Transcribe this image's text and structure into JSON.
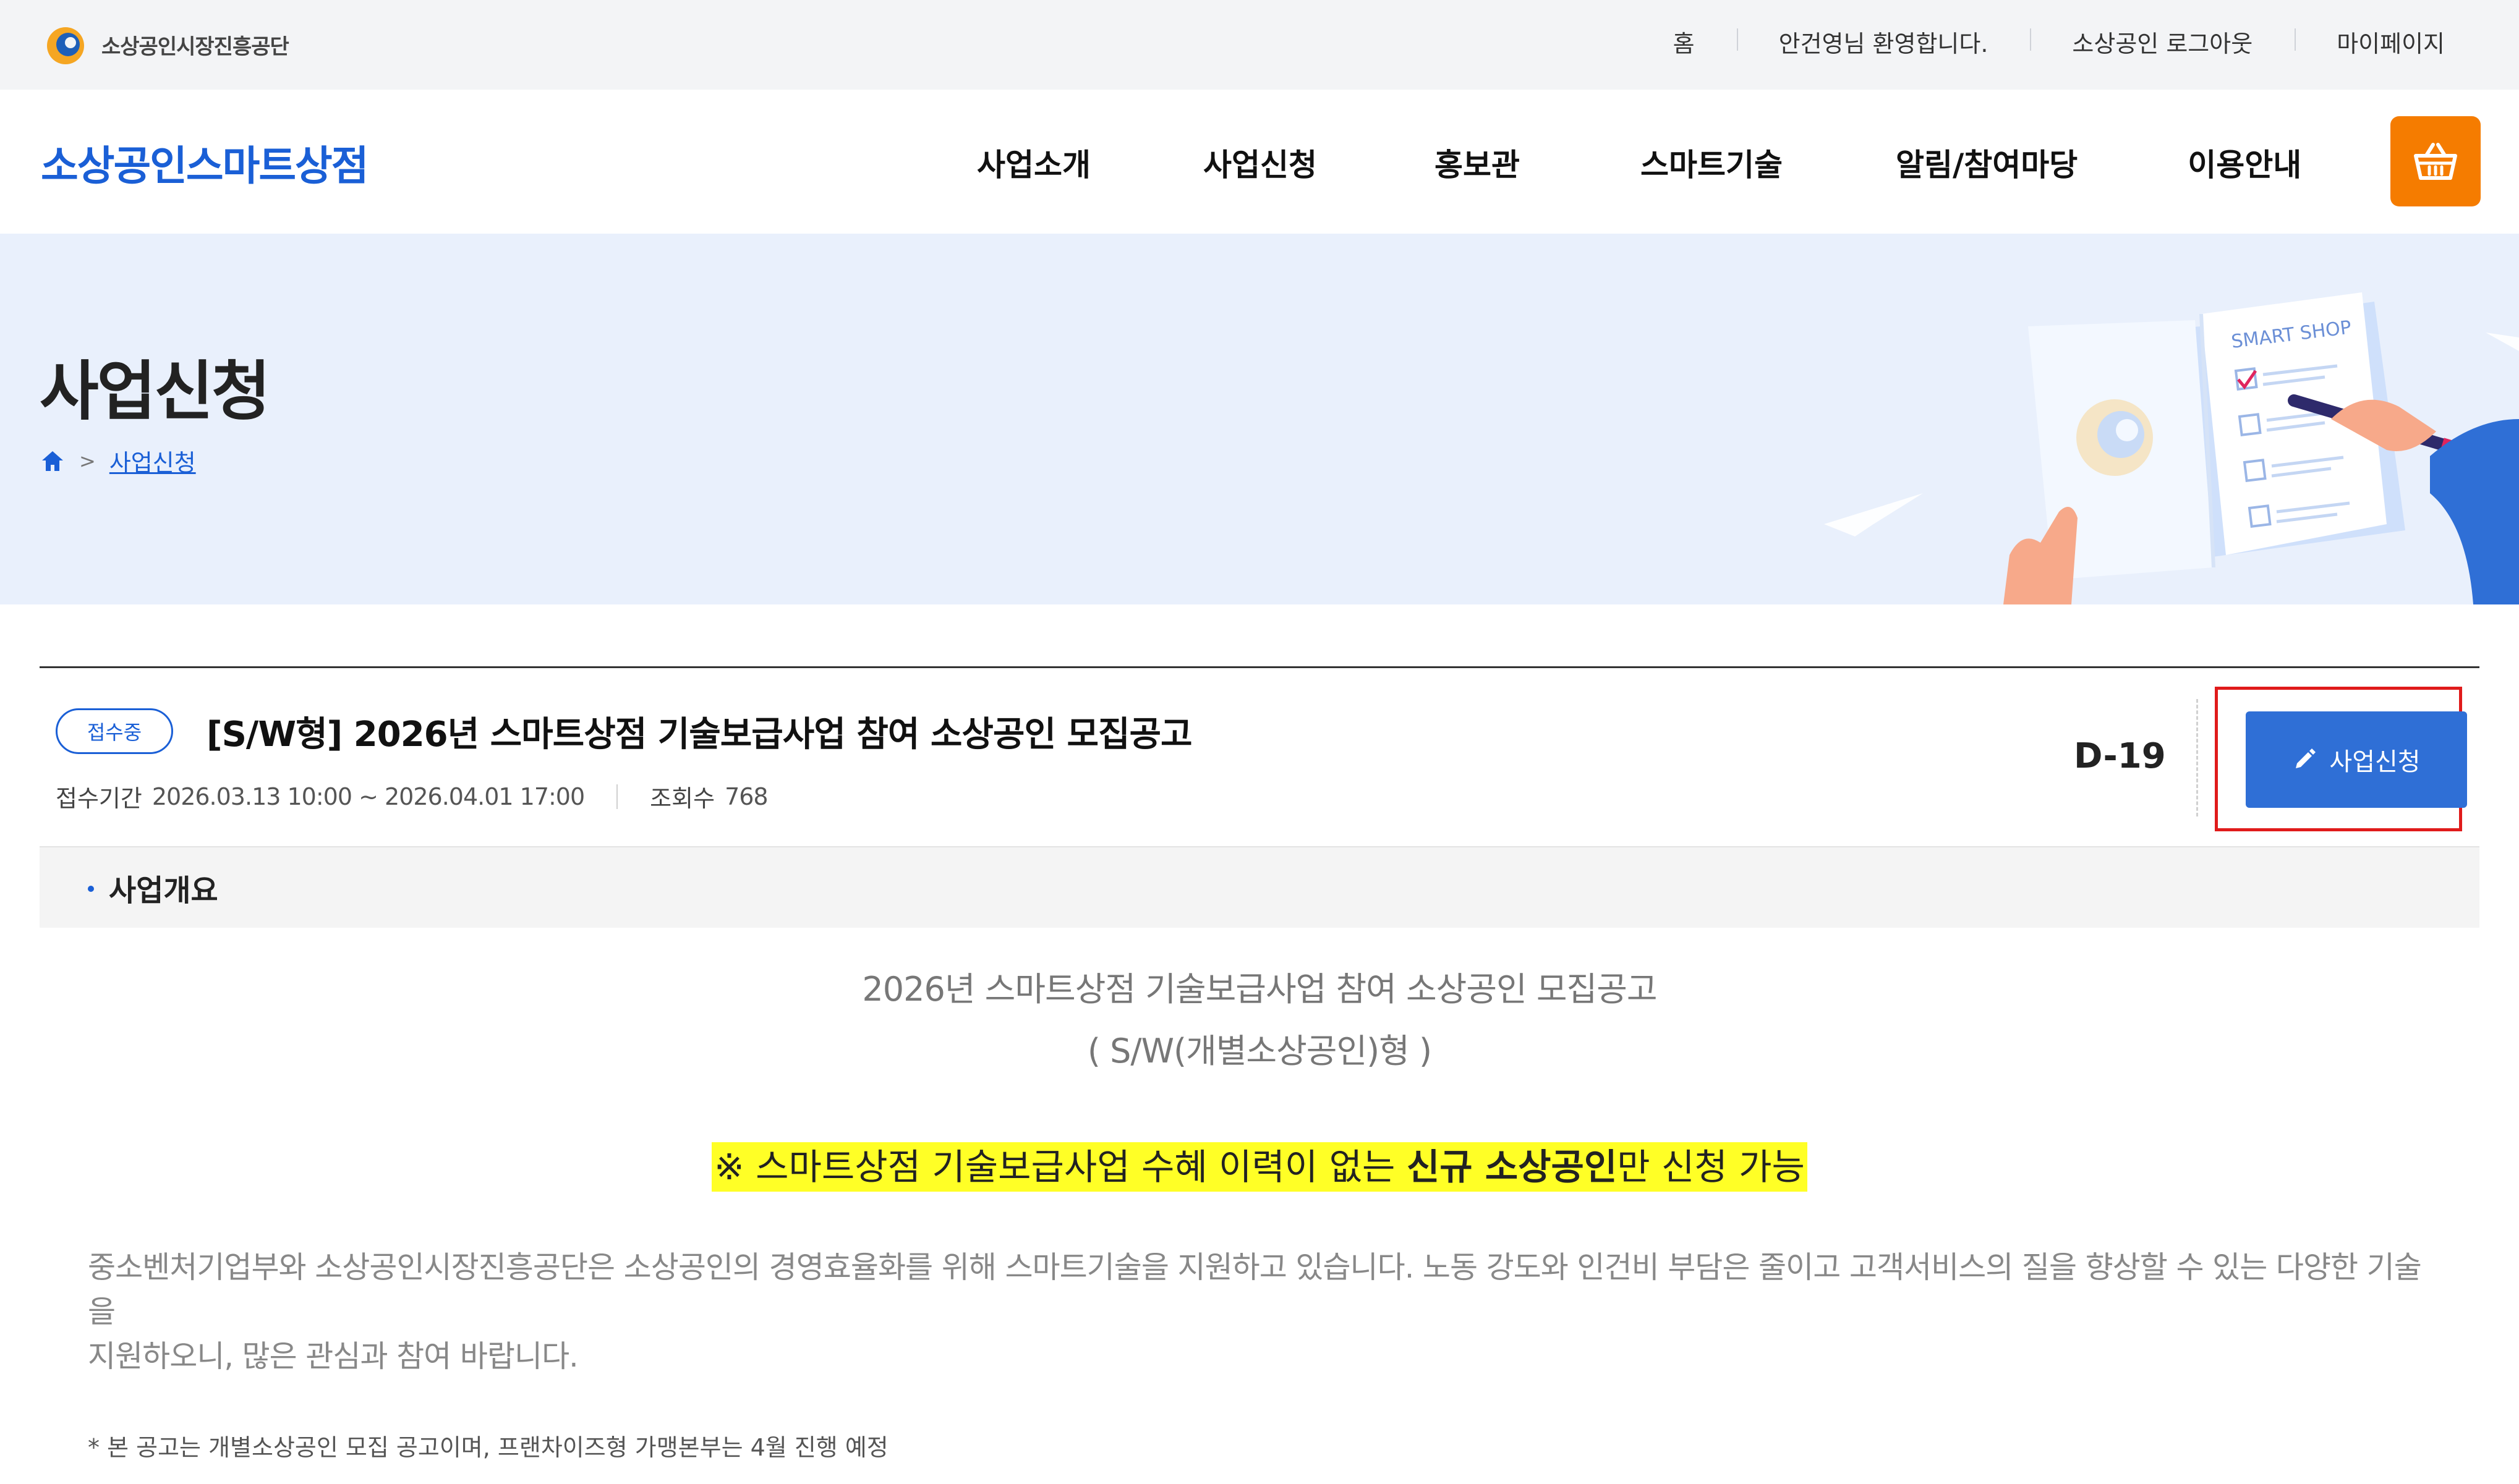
{
  "topbar": {
    "org_name": "소상공인시장진흥공단",
    "links": [
      "홈",
      "안건영님 환영합니다.",
      "소상공인 로그아웃",
      "마이페이지"
    ]
  },
  "header": {
    "brand": "소상공인스마트상점",
    "menu": [
      "사업소개",
      "사업신청",
      "홍보관",
      "스마트기술",
      "알림/참여마당",
      "이용안내"
    ],
    "cart_icon": "basket-icon",
    "accent_color": "#f57c00"
  },
  "hero": {
    "title": "사업신청",
    "breadcrumb": "사업신청",
    "illustration_text": "SMART SHOP"
  },
  "notice": {
    "status_badge": "접수중",
    "title": "[S/W형] 2026년 스마트상점 기술보급사업 참여 소상공인 모집공고",
    "period_label": "접수기간",
    "period_value": "2026.03.13 10:00 ~ 2026.04.01 17:00",
    "views_label": "조회수",
    "views_value": "768",
    "dday": "D-19",
    "apply_label": "사업신청"
  },
  "section": {
    "heading": "사업개요"
  },
  "body": {
    "title_line1": "2026년 스마트상점 기술보급사업 참여 소상공인 모집공고",
    "title_line2": "( S/W(개별소상공인)형 )",
    "highlight_pre": "※ 스마트상점 기술보급사업 수혜 이력이 없는 ",
    "highlight_bold": "신규 소상공인",
    "highlight_post": "만 신청 가능",
    "paragraph_line1": "중소벤처기업부와 소상공인시장진흥공단은 소상공인의 경영효율화를 위해 스마트기술을 지원하고 있습니다. 노동 강도와 인건비 부담은 줄이고 고객서비스의 질을 향상할 수 있는 다양한 기술을",
    "paragraph_line2": "지원하오니, 많은 관심과 참여 바랍니다.",
    "footnote": "* 본 공고는 개별소상공인 모집 공고이며, 프랜차이즈형 가맹본부는 4월 진행 예정"
  }
}
